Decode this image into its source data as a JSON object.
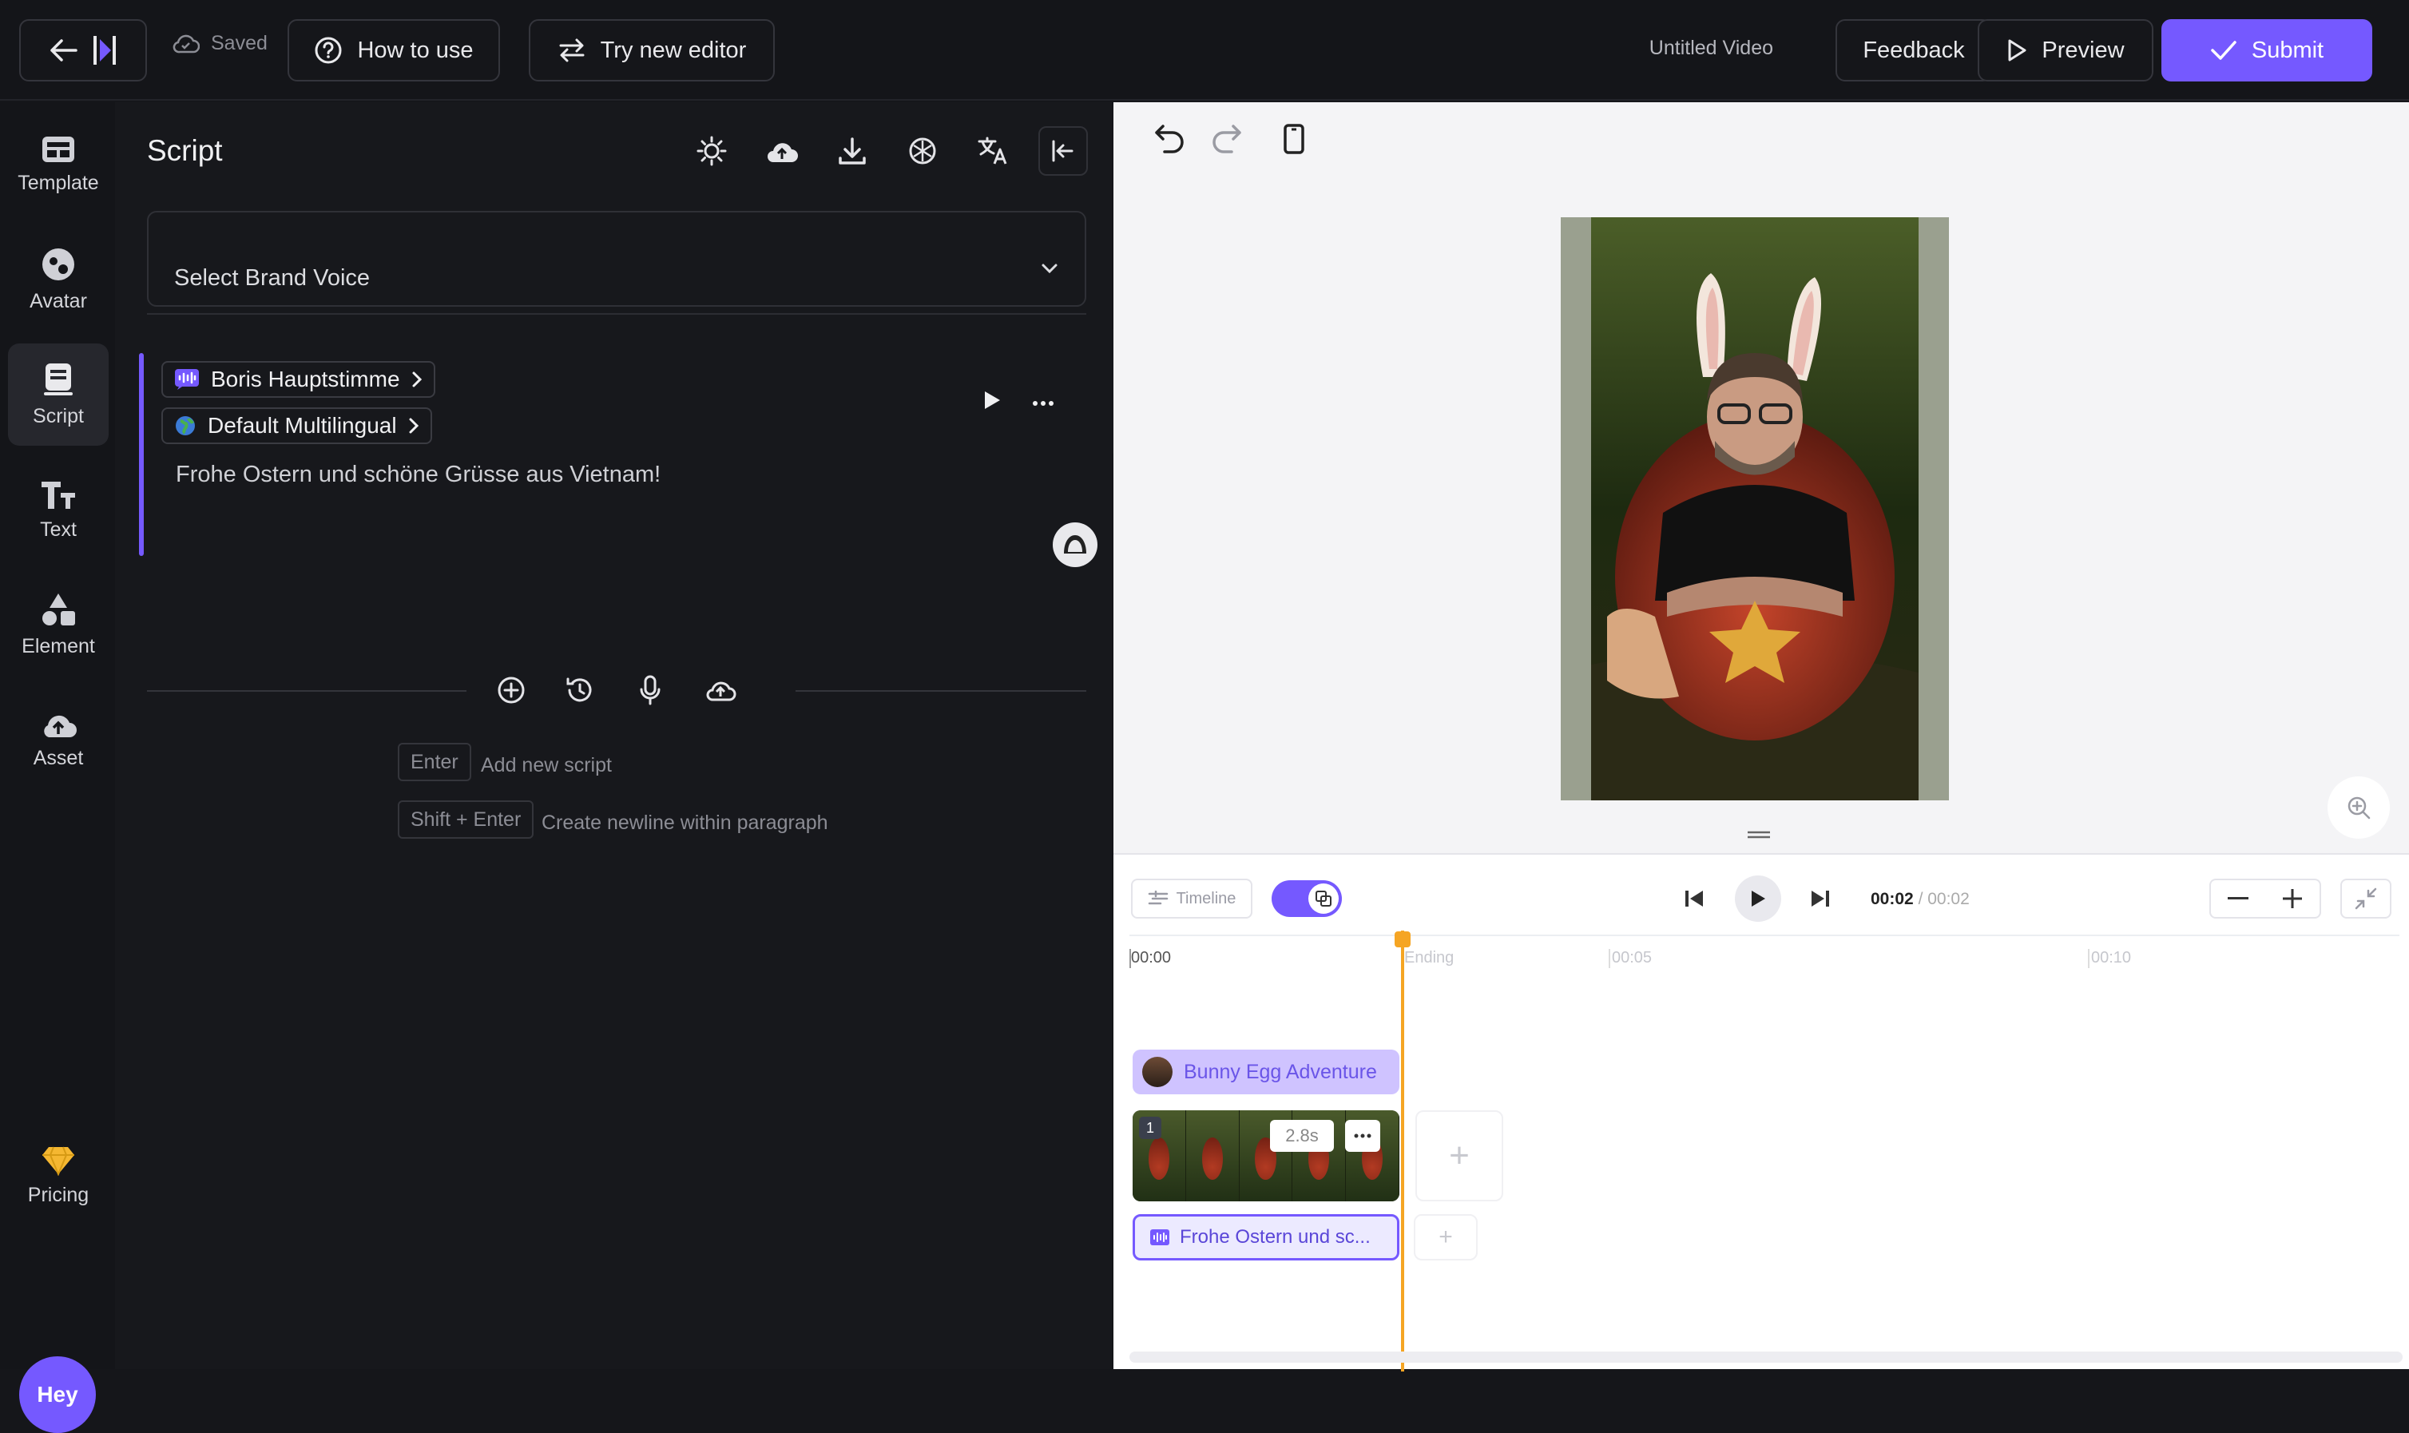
{
  "topbar": {
    "saved_label": "Saved",
    "how_to_use": "How to use",
    "try_new_editor": "Try new editor",
    "video_title": "Untitled Video",
    "feedback": "Feedback",
    "preview": "Preview",
    "submit": "Submit"
  },
  "nav": {
    "items": [
      {
        "label": "Template",
        "icon": "template-icon"
      },
      {
        "label": "Avatar",
        "icon": "avatar-icon"
      },
      {
        "label": "Script",
        "icon": "script-icon",
        "active": true
      },
      {
        "label": "Text",
        "icon": "text-icon"
      },
      {
        "label": "Element",
        "icon": "element-icon"
      },
      {
        "label": "Asset",
        "icon": "asset-icon"
      }
    ],
    "pricing": "Pricing",
    "hey": "Hey"
  },
  "script": {
    "title": "Script",
    "brand_voice_placeholder": "Select Brand Voice",
    "voice_name": "Boris Hauptstimme",
    "voice_model": "Default Multilingual",
    "text": "Frohe Ostern und schöne Grüsse aus Vietnam!",
    "shortcuts": [
      {
        "key": "Enter",
        "desc": "Add new script"
      },
      {
        "key": "Shift + Enter",
        "desc": "Create newline within paragraph"
      }
    ]
  },
  "timeline": {
    "label": "Timeline",
    "current_time": "00:02",
    "total_time": "/ 00:02",
    "ticks": [
      "00:00",
      "Ending",
      "00:05",
      "00:10"
    ],
    "avatar_track": "Bunny Egg Adventure",
    "scene_number": "1",
    "scene_duration": "2.8s",
    "text_track": "Frohe Ostern und sc..."
  },
  "colors": {
    "accent": "#7559ff",
    "playhead": "#f5a524"
  }
}
